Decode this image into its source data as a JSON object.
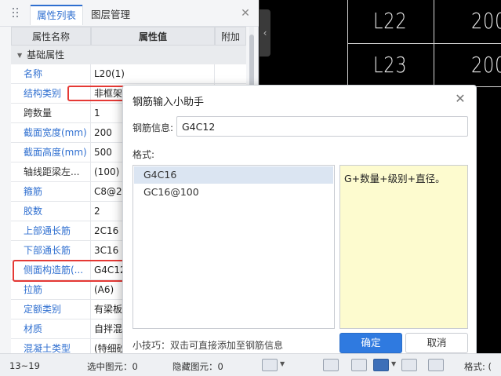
{
  "panel": {
    "tabs": [
      {
        "label": "属性列表",
        "active": true
      },
      {
        "label": "图层管理",
        "active": false
      }
    ],
    "columns": {
      "name": "属性名称",
      "value": "属性值",
      "add": "附加"
    },
    "section_label": "基础属性",
    "rows": [
      {
        "name": "名称",
        "value": "L20(1)",
        "link": true
      },
      {
        "name": "结构类别",
        "value": "非框架",
        "link": true
      },
      {
        "name": "跨数量",
        "value": "1",
        "link": false
      },
      {
        "name": "截面宽度(mm)",
        "value": "200",
        "link": true
      },
      {
        "name": "截面高度(mm)",
        "value": "500",
        "link": true
      },
      {
        "name": "轴线距梁左...",
        "value": "(100)",
        "link": false
      },
      {
        "name": "箍筋",
        "value": "C8@20",
        "link": true
      },
      {
        "name": "胶数",
        "value": "2",
        "link": true
      },
      {
        "name": "上部通长筋",
        "value": "2C16",
        "link": true
      },
      {
        "name": "下部通长筋",
        "value": "3C16",
        "link": true
      },
      {
        "name": "侧面构造筋(...",
        "value": "G4C12",
        "link": true
      },
      {
        "name": "拉筋",
        "value": "(A6)",
        "link": true
      },
      {
        "name": "定额类别",
        "value": "有梁板",
        "link": true
      },
      {
        "name": "材质",
        "value": "自拌混",
        "link": true
      },
      {
        "name": "混凝土类型",
        "value": "(特细砂",
        "link": true
      }
    ]
  },
  "canvas": {
    "labels": [
      "L22",
      "L23",
      "200",
      "200"
    ]
  },
  "dialog": {
    "title": "钢筋输入小助手",
    "info_label": "钢筋信息:",
    "info_value": "G4C12",
    "format_label": "格式:",
    "formats": [
      {
        "label": "G4C16",
        "selected": true
      },
      {
        "label": "GC16@100",
        "selected": false
      }
    ],
    "description": "G+数量+级别+直径。",
    "tip": "小技巧：双击可直接添加至钢筋信息",
    "ok_label": "确定",
    "cancel_label": "取消"
  },
  "statusbar": {
    "range": "13~19",
    "selected": "选中图元：0",
    "hidden": "隐藏图元：0",
    "format_label": "格式: ("
  },
  "colors": {
    "accent": "#2f7ae0",
    "link": "#2f6fd0",
    "highlight": "#e53935",
    "desc_bg": "#fdfbcf"
  }
}
